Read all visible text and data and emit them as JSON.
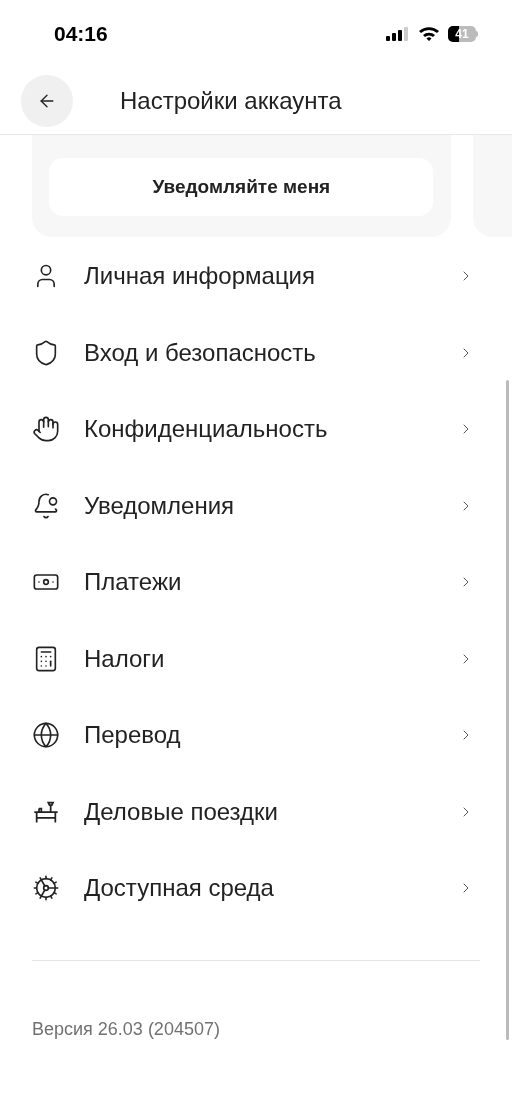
{
  "status_bar": {
    "time": "04:16",
    "battery": "41"
  },
  "header": {
    "title": "Настройки аккаунта"
  },
  "card": {
    "button": "Уведомляйте меня"
  },
  "menu": [
    {
      "kind": "person",
      "label": "Личная информация"
    },
    {
      "kind": "shield",
      "label": "Вход и безопасность"
    },
    {
      "kind": "hand",
      "label": "Конфиденциальность"
    },
    {
      "kind": "bell",
      "label": "Уведомления"
    },
    {
      "kind": "money",
      "label": "Платежи"
    },
    {
      "kind": "calculator",
      "label": "Налоги"
    },
    {
      "kind": "globe",
      "label": "Перевод"
    },
    {
      "kind": "desk",
      "label": "Деловые поездки"
    },
    {
      "kind": "gear",
      "label": "Доступная среда"
    }
  ],
  "version": "Версия 26.03 (204507)"
}
